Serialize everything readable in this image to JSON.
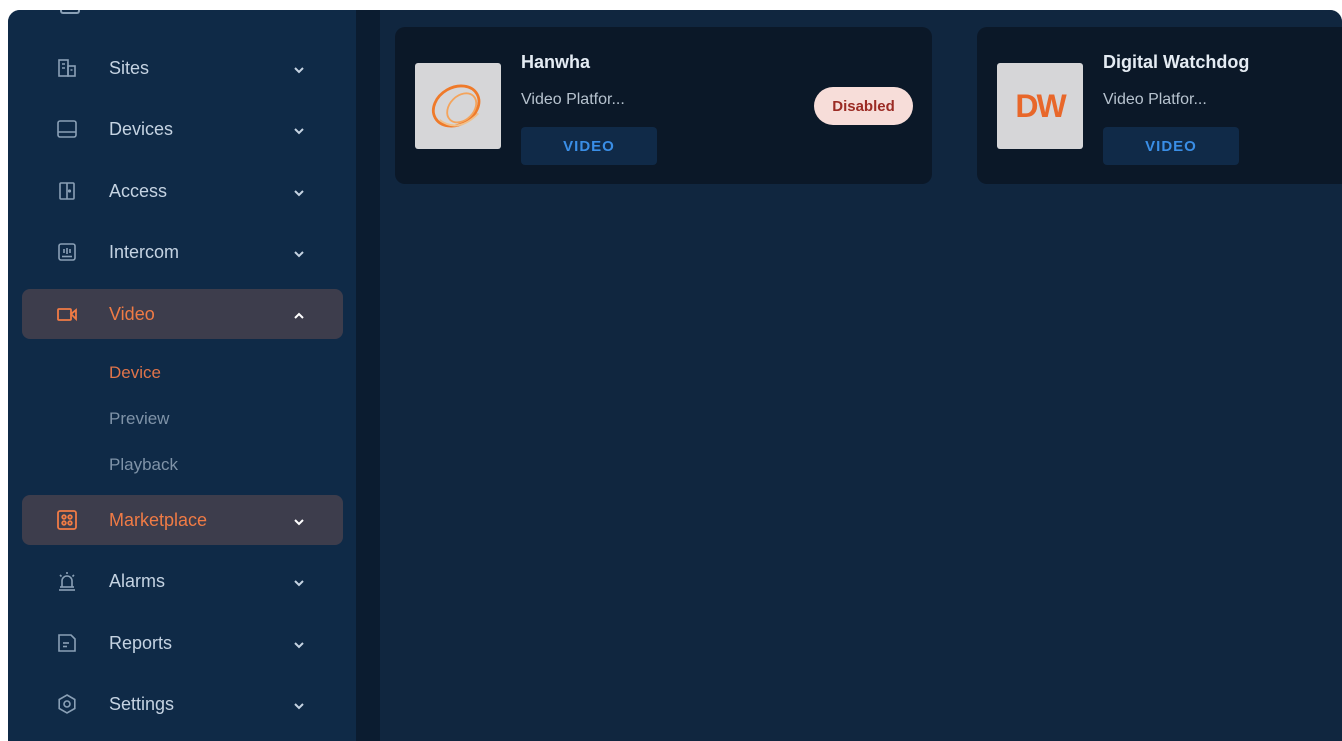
{
  "sidebar": {
    "items": [
      {
        "label": "Sites",
        "icon": "building-icon"
      },
      {
        "label": "Devices",
        "icon": "device-icon"
      },
      {
        "label": "Access",
        "icon": "door-icon"
      },
      {
        "label": "Intercom",
        "icon": "intercom-icon"
      },
      {
        "label": "Video",
        "icon": "video-camera-icon"
      },
      {
        "label": "Marketplace",
        "icon": "marketplace-icon"
      },
      {
        "label": "Alarms",
        "icon": "siren-icon"
      },
      {
        "label": "Reports",
        "icon": "report-icon"
      },
      {
        "label": "Settings",
        "icon": "gear-icon"
      }
    ],
    "video_sub": [
      {
        "label": "Device"
      },
      {
        "label": "Preview"
      },
      {
        "label": "Playback"
      }
    ]
  },
  "cards": [
    {
      "title": "Hanwha",
      "subtitle": "Video Platfor...",
      "tag": "VIDEO",
      "status": "Disabled",
      "logo": "hanwha-logo"
    },
    {
      "title": "Digital Watchdog",
      "subtitle": "Video Platfor...",
      "tag": "VIDEO",
      "logo_text": "DW"
    }
  ],
  "colors": {
    "accent": "#f07b45",
    "sidebar_bg": "#0f2a47",
    "main_bg": "#10263f",
    "card_bg": "#0b1828",
    "tag_text": "#3a8ee6",
    "badge_bg": "#f7ddd9"
  }
}
